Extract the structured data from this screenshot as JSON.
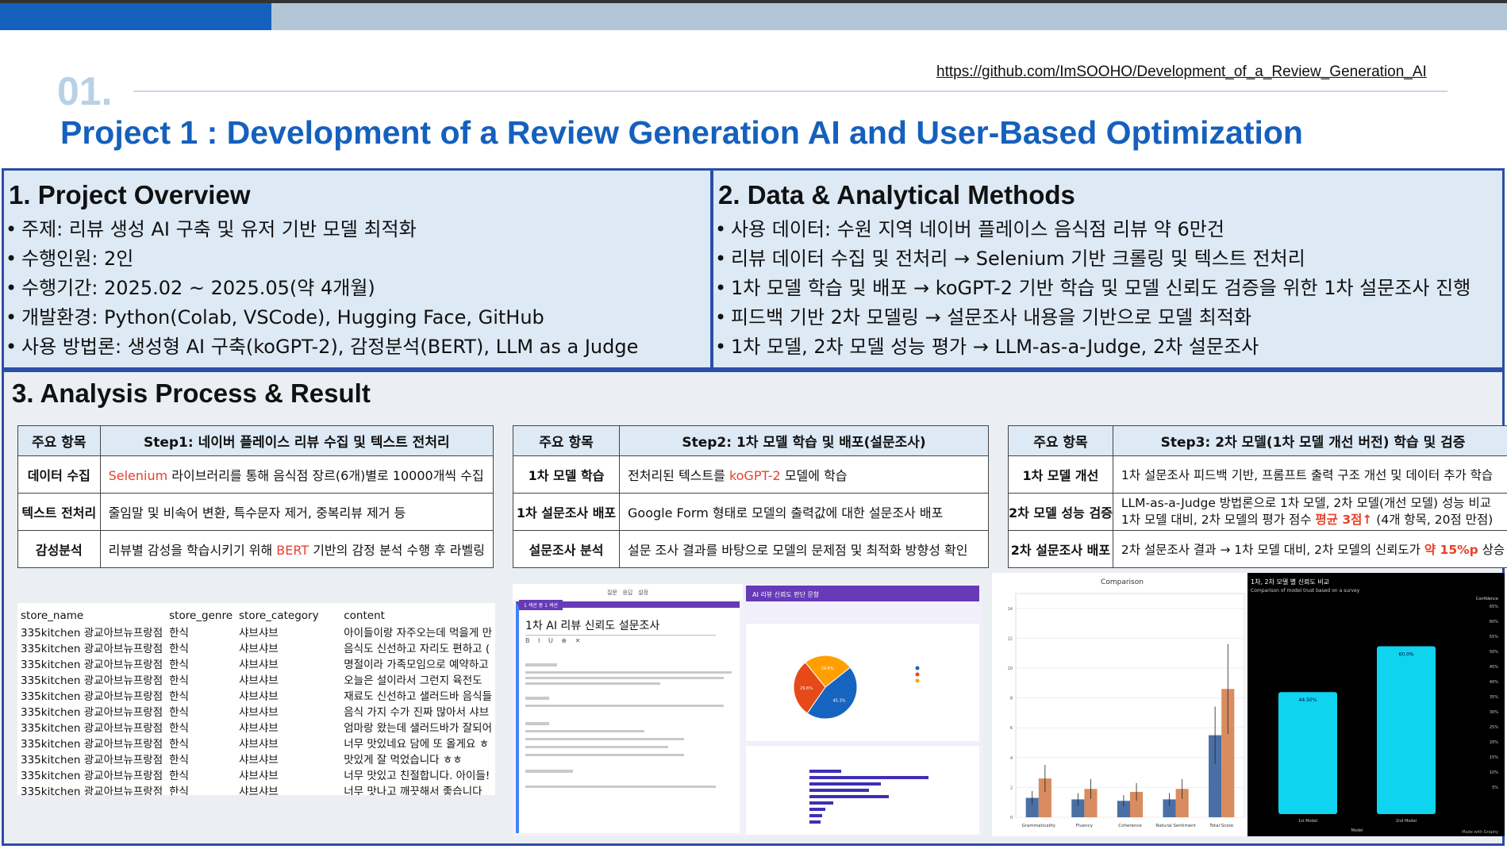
{
  "section_number": "01.",
  "repo_link": "https://github.com/ImSOOHO/Development_of_a_Review_Generation_AI",
  "title": "Project 1 : Development of a Review Generation AI and User-Based Optimization",
  "overview": {
    "heading": "1. Project Overview",
    "items": [
      "주제: 리뷰 생성 AI 구축 및 유저 기반 모델 최적화",
      "수행인원: 2인",
      "수행기간: 2025.02 ~ 2025.05(약 4개월)",
      "개발환경: Python(Colab, VSCode), Hugging Face, GitHub",
      "사용 방법론: 생성형 AI 구축(koGPT-2), 감정분석(BERT), LLM as a Judge"
    ]
  },
  "methods": {
    "heading": "2. Data & Analytical Methods",
    "items": [
      "사용 데이터: 수원 지역 네이버 플레이스 음식점 리뷰 약 6만건",
      "리뷰 데이터 수집 및 전처리 → Selenium 기반 크롤링 및 텍스트 전처리",
      "1차 모델 학습 및 배포 → koGPT-2 기반 학습 및 모델 신뢰도 검증을 위한 1차 설문조사 진행",
      "피드백 기반 2차 모델링 → 설문조사 내용을 기반으로 모델 최적화",
      "1차 모델, 2차 모델 성능 평가 → LLM-as-a-Judge, 2차 설문조사"
    ]
  },
  "analysis": {
    "heading": "3. Analysis Process & Result",
    "step1": {
      "col1": "주요 항목",
      "col2": "Step1: 네이버 플레이스 리뷰 수집 및 텍스트 전처리",
      "rows": [
        {
          "k": "데이터 수집",
          "hl": "Selenium",
          "rest": " 라이브러리를 통해 음식점 장르(6개)별로 10000개씩 수집"
        },
        {
          "k": "텍스트 전처리",
          "v": "줄임말 및 비속어 변환, 특수문자 제거, 중복리뷰 제거 등"
        },
        {
          "k": "감성분석",
          "pre": "리뷰별 감성을 학습시키기 위해  ",
          "hl": "BERT",
          "rest": " 기반의 감정 분석 수행 후 라벨링"
        }
      ]
    },
    "step2": {
      "col1": "주요 항목",
      "col2": "Step2: 1차 모델 학습 및 배포(설문조사)",
      "rows": [
        {
          "k": "1차 모델 학습",
          "pre": "전처리된 텍스트를 ",
          "hl": "koGPT-2",
          "rest": " 모델에 학습"
        },
        {
          "k": "1차 설문조사 배포",
          "v": "Google Form 형태로 모델의 출력값에 대한 설문조사 배포"
        },
        {
          "k": "설문조사 분석",
          "v": "설문 조사 결과를 바탕으로 모델의 문제점 및 최적화 방향성 확인"
        }
      ]
    },
    "step3": {
      "col1": "주요 항목",
      "col2": "Step3: 2차 모델(1차 모델 개선 버전) 학습 및 검증",
      "rows": [
        {
          "k": "1차 모델 개선",
          "v": "1차 설문조사 피드백 기반, 프롬프트 출력 구조 개선 및 데이터 추가 학습"
        },
        {
          "k": "2차 모델 성능 검증",
          "v1": "LLM-as-a-Judge 방법론으로 1차 모델, 2차 모델(개선 모델) 성능 비교",
          "v2pre": "1차 모델 대비, 2차 모델의 평가 점수 ",
          "v2hl": "평균 3점↑",
          "v2rest": " (4개 항목, 20점 만점)"
        },
        {
          "k": "2차 설문조사 배포",
          "pre": "2차 설문조사 결과 → 1차 모델 대비, 2차 모델의 신뢰도가 ",
          "hl": "약 15%p",
          "rest": " 상승"
        }
      ]
    }
  },
  "data_sample": {
    "headers": [
      "store_name",
      "store_genre",
      "store_category",
      "content"
    ],
    "rows": [
      [
        "335kitchen 광교아브뉴프랑점",
        "한식",
        "샤브샤브",
        "아이들이랑 자주오는데 먹을게 만"
      ],
      [
        "335kitchen 광교아브뉴프랑점",
        "한식",
        "샤브샤브",
        "음식도 신선하고 자리도 편하고 ("
      ],
      [
        "335kitchen 광교아브뉴프랑점",
        "한식",
        "샤브샤브",
        "명절이라 가족모임으로 예약하고"
      ],
      [
        "335kitchen 광교아브뉴프랑점",
        "한식",
        "샤브샤브",
        "오늘은 설이라서 그런지 육전도"
      ],
      [
        "335kitchen 광교아브뉴프랑점",
        "한식",
        "샤브샤브",
        "재료도 신선하고 샐러드바 음식들"
      ],
      [
        "335kitchen 광교아브뉴프랑점",
        "한식",
        "샤브샤브",
        "음식 가지 수가 진짜 많아서 샤브"
      ],
      [
        "335kitchen 광교아브뉴프랑점",
        "한식",
        "샤브샤브",
        "엄마랑 왔는데 샐러드바가 잘되어"
      ],
      [
        "335kitchen 광교아브뉴프랑점",
        "한식",
        "샤브샤브",
        "너무 맛있네요 담에 또 올게요 ㅎ"
      ],
      [
        "335kitchen 광교아브뉴프랑점",
        "한식",
        "샤브샤브",
        "맛있게 잘 먹었습니다 ㅎㅎ"
      ],
      [
        "335kitchen 광교아브뉴프랑점",
        "한식",
        "샤브샤브",
        "너무 맛있고 친절합니다. 아이들!"
      ],
      [
        "335kitchen 광교아브뉴프랑점",
        "한식",
        "샤브샤브",
        "너무 맛나고 깨끗해서 좋습니다"
      ]
    ]
  },
  "survey_form": {
    "tabs": [
      "질문",
      "응답",
      "설정"
    ],
    "section_tag": "1 섹션 중 1 섹션",
    "form_title": "1차 AI 리뷰 신뢰도 설문조사",
    "toolbar": [
      "B",
      "I",
      "U",
      "⊕",
      "✕"
    ]
  },
  "survey_results": {
    "header_title": "AI 리뷰 신뢰도 판단 문항",
    "pie_values_pct": [
      45.3,
      29.6,
      25.1
    ],
    "pie_colors": [
      "#1565c0",
      "#e64a19",
      "#ffa000"
    ],
    "pie_labels": [
      "45.3%",
      "29.6%",
      "24.6%"
    ]
  },
  "comparison_chart": {
    "title": "Comparison",
    "categories": [
      "Grammaticality",
      "Fluency",
      "Coherence",
      "Natural Sentiment",
      "Total Score"
    ],
    "series": [
      {
        "values": [
          1.3,
          1.2,
          1.1,
          1.2,
          5.5
        ],
        "color": "#4a6fa5"
      },
      {
        "values": [
          2.6,
          1.9,
          1.7,
          1.9,
          8.6
        ],
        "color": "#d98c5f"
      }
    ],
    "y_ticks": [
      "0",
      "2",
      "4",
      "6",
      "8",
      "10",
      "12",
      "14"
    ],
    "ylim": [
      0,
      15
    ]
  },
  "trust_chart": {
    "title": "1차, 2차 모델 별 신뢰도 비교",
    "subtitle": "Comparison of model trust based on a survey",
    "categories": [
      "1st Model",
      "2nd Model"
    ],
    "values": [
      44.5,
      60.0
    ],
    "value_labels": [
      "44.50%",
      "60.0%"
    ],
    "x_label": "Model",
    "legend_label": "Confidence",
    "colorbar_ticks": [
      "65%",
      "60%",
      "55%",
      "50%",
      "45%",
      "40%",
      "35%",
      "30%",
      "25%",
      "20%",
      "15%",
      "10%",
      "5%"
    ],
    "credit": "Made with Graphy",
    "color": "#0fd4f0"
  }
}
